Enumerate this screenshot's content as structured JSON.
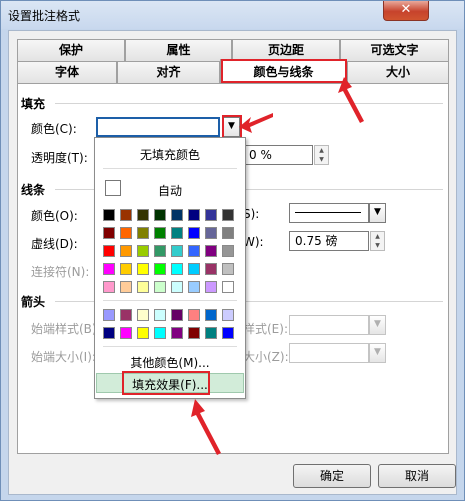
{
  "window": {
    "title": "设置批注格式",
    "close": "✕"
  },
  "tabs": {
    "row1": [
      "保护",
      "属性",
      "页边距",
      "可选文字"
    ],
    "row2": [
      "字体",
      "对齐",
      "颜色与线条",
      "大小"
    ]
  },
  "fill": {
    "section": "填充",
    "color_label": "颜色(C):",
    "transparency_label": "透明度(T):",
    "transparency_value": "0 %"
  },
  "line": {
    "section": "线条",
    "color_label": "颜色(O):",
    "dash_label": "虚线(D):",
    "connector_label": "连接符(N):",
    "style_label_tail": "S):",
    "weight_label_tail": "W):",
    "weight_value": "0.75 磅"
  },
  "arrows": {
    "section": "箭头",
    "begin_style_label": "始端样式(B)",
    "begin_size_label": "始端大小(I):",
    "end_style_label_tail": "样式(E):",
    "end_size_label_tail": "大小(Z):"
  },
  "popup": {
    "no_fill": "无填充颜色",
    "auto": "自动",
    "more_colors": "其他颜色(M)...",
    "fill_effects": "填充效果(F)...",
    "palette": [
      [
        "#000000",
        "#993300",
        "#333300",
        "#003300",
        "#003366",
        "#000080",
        "#333399",
        "#333333"
      ],
      [
        "#800000",
        "#FF6600",
        "#808000",
        "#008000",
        "#008080",
        "#0000FF",
        "#666699",
        "#808080"
      ],
      [
        "#FF0000",
        "#FF9900",
        "#99CC00",
        "#339966",
        "#33CCCC",
        "#3366FF",
        "#800080",
        "#969696"
      ],
      [
        "#FF00FF",
        "#FFCC00",
        "#FFFF00",
        "#00FF00",
        "#00FFFF",
        "#00CCFF",
        "#993366",
        "#C0C0C0"
      ],
      [
        "#FF99CC",
        "#FFCC99",
        "#FFFF99",
        "#CCFFCC",
        "#CCFFFF",
        "#99CCFF",
        "#CC99FF",
        "#FFFFFF"
      ]
    ],
    "chart_palette": [
      [
        "#9999FF",
        "#993366",
        "#FFFFCC",
        "#CCFFFF",
        "#660066",
        "#FF8080",
        "#0066CC",
        "#CCCCFF"
      ],
      [
        "#000080",
        "#FF00FF",
        "#FFFF00",
        "#00FFFF",
        "#800080",
        "#800000",
        "#008080",
        "#0000FF"
      ]
    ]
  },
  "buttons": {
    "ok": "确定",
    "cancel": "取消"
  },
  "colors": {
    "highlight": "#e0232a"
  }
}
